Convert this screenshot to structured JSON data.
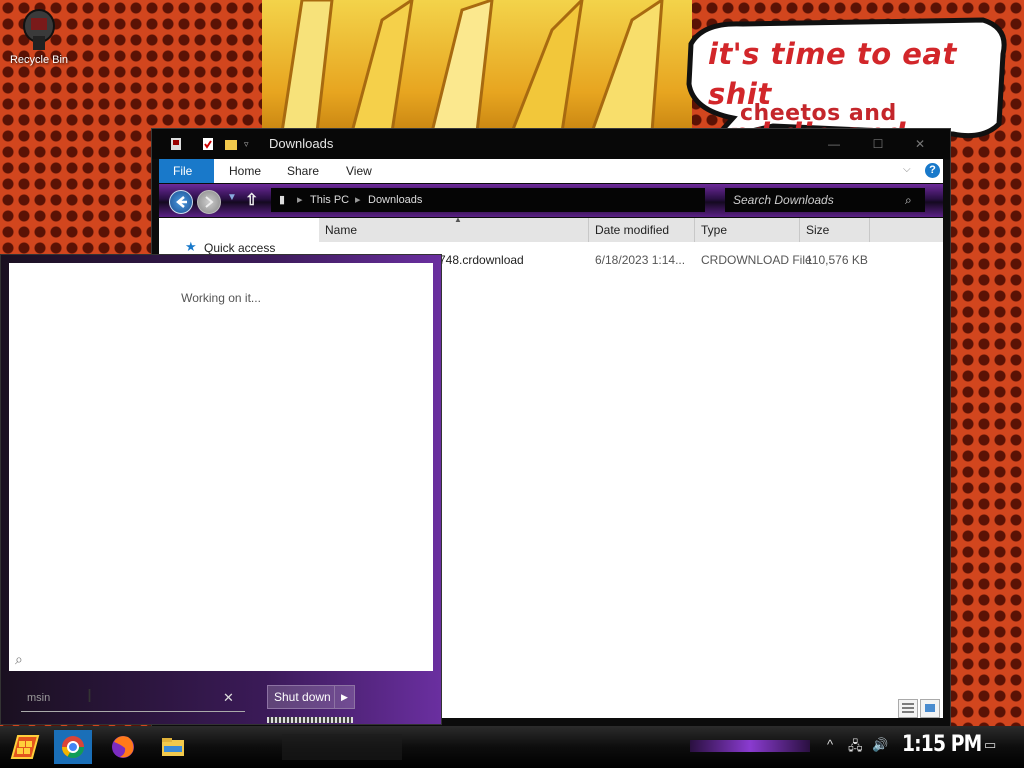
{
  "desktop": {
    "recycle_bin_label": "Recycle Bin",
    "speech_bubble": {
      "line1": "it's time to eat shit",
      "line2": "and die and chew",
      "line3": "cheetos and"
    }
  },
  "explorer": {
    "title": "Downloads",
    "ribbon_tabs": [
      "File",
      "Home",
      "Share",
      "View"
    ],
    "breadcrumb": [
      "This PC",
      "Downloads"
    ],
    "search_placeholder": "Search Downloads",
    "nav_pane": {
      "quick_access": "Quick access"
    },
    "columns": [
      "Name",
      "Date modified",
      "Type",
      "Size"
    ],
    "files": [
      {
        "name": "748.crdownload",
        "date_modified": "6/18/2023 1:14...",
        "type": "CRDOWNLOAD File",
        "size": "110,576 KB"
      }
    ]
  },
  "start_menu": {
    "status_text": "Working on it...",
    "search_value": "msin",
    "shutdown_label": "Shut down"
  },
  "taskbar": {
    "clock": "1:15 PM",
    "pinned": [
      "start-icon",
      "chrome-icon",
      "firefox-icon",
      "file-explorer-icon"
    ]
  },
  "colors": {
    "accent": "#1979ca",
    "wallpaper_orange": "#d2461e",
    "speech_red": "#d2262a",
    "nav_purple": "#6d2a9a"
  }
}
